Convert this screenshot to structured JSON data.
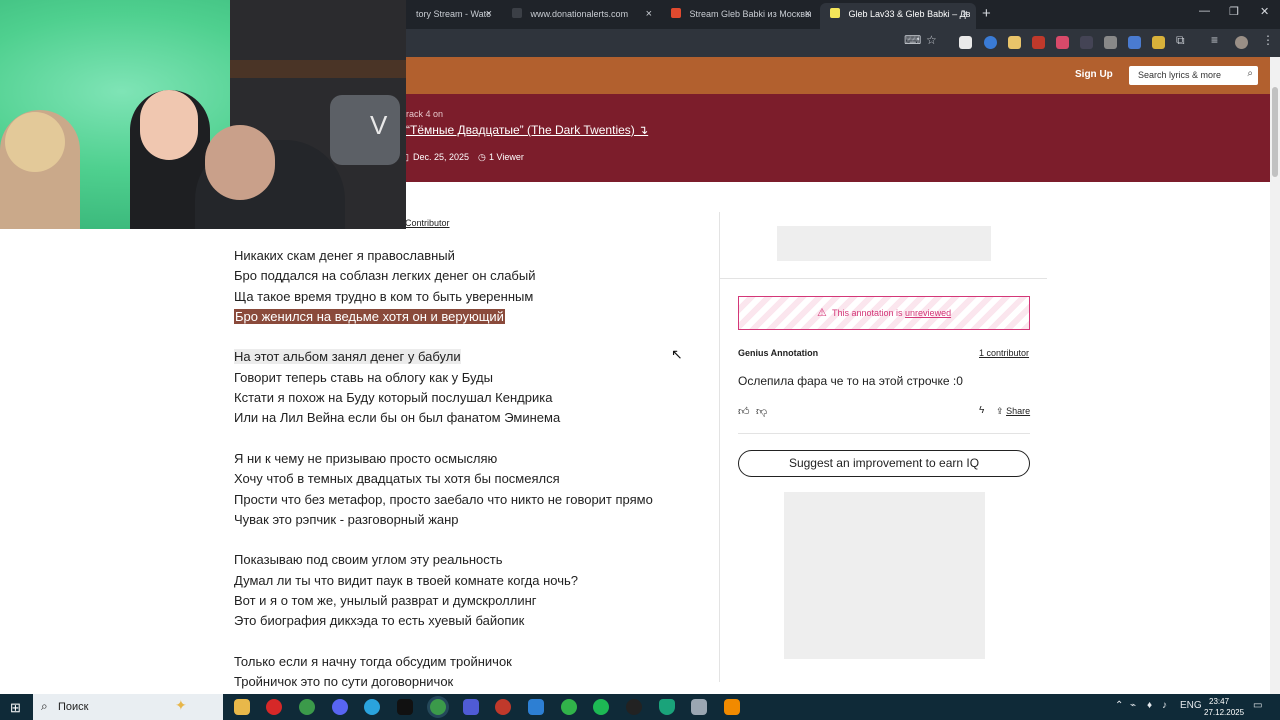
{
  "browser": {
    "tabs": [
      {
        "label": "tory Stream - Watc",
        "active": false
      },
      {
        "label": "www.donationalerts.com",
        "active": false
      },
      {
        "label": "Stream Gleb Babki из Москвы",
        "active": false
      },
      {
        "label": "Gleb Lav33 & Gleb Babki – Дв",
        "active": true
      }
    ],
    "new_tab": "+",
    "close_glyph": "×",
    "window_controls": [
      "—",
      "❐",
      "✕"
    ]
  },
  "header": {
    "sign_up": "Sign Up",
    "search_placeholder": "Search lyrics & more",
    "search_icon": "search-icon"
  },
  "hero": {
    "track_label": "rack 4 on",
    "album_title": "“Тёмные Двадцатые” (The Dark Twenties) ↴",
    "date": "Dec. 25, 2025",
    "viewers": "1 Viewer"
  },
  "contributor_link": "Contributor",
  "lyrics": [
    {
      "text": "Никаких скам денег я православный",
      "hl": ""
    },
    {
      "text": "Бро поддался на соблазн легких денег он слабый",
      "hl": ""
    },
    {
      "text": "Ща такое время трудно в ком то быть уверенным",
      "hl": ""
    },
    {
      "text": "Бро женился на ведьме хотя он и верующий",
      "hl": "active"
    },
    {
      "text": "",
      "hl": ""
    },
    {
      "text": "На этот альбом занял денег у бабули",
      "hl": "soft"
    },
    {
      "text": "Говорит теперь ставь на облогу как у Буды",
      "hl": ""
    },
    {
      "text": "Кстати я похож на Буду который послушал Кендрика",
      "hl": ""
    },
    {
      "text": "Или на Лил Вейна если бы он был фанатом Эминема",
      "hl": ""
    },
    {
      "text": "",
      "hl": ""
    },
    {
      "text": "Я ни к чему не призываю просто осмысляю",
      "hl": ""
    },
    {
      "text": "Хочу чтоб в темных двадцатых ты хотя бы посмеялся",
      "hl": ""
    },
    {
      "text": "Прости что без метафор, просто заебало что никто не говорит прямо",
      "hl": ""
    },
    {
      "text": "Чувак это рэпчик - разговорный жанр",
      "hl": ""
    },
    {
      "text": "",
      "hl": ""
    },
    {
      "text": "Показываю под своим углом эту реальность",
      "hl": ""
    },
    {
      "text": "Думал ли ты что видит паук в твоей комнате когда ночь?",
      "hl": ""
    },
    {
      "text": "Вот и я о том же, унылый разврат и думскроллинг",
      "hl": ""
    },
    {
      "text": "Это биография дикхэда то есть хуевый байопик",
      "hl": ""
    },
    {
      "text": "",
      "hl": ""
    },
    {
      "text": "Только если я начну тогда обсудим тройничок",
      "hl": ""
    },
    {
      "text": "Тройничок это по сути договорничок",
      "hl": ""
    }
  ],
  "annotation": {
    "status_prefix": "This annotation is ",
    "status_link": "unreviewed",
    "title": "Genius Annotation",
    "contributors": "1 contributor",
    "body": "Ослепила фара че то на этой строчке :0",
    "share": "Share",
    "suggest": "Suggest an improvement to earn IQ"
  },
  "taskbar": {
    "search_placeholder": "Поиск",
    "lang": "ENG",
    "time": "23:47",
    "date": "27.12.2025"
  },
  "colors": {
    "nav": "#b2602e",
    "hero": "#7c1d2b",
    "highlight": "#8a4a3b",
    "unreviewed": "#d33778"
  }
}
